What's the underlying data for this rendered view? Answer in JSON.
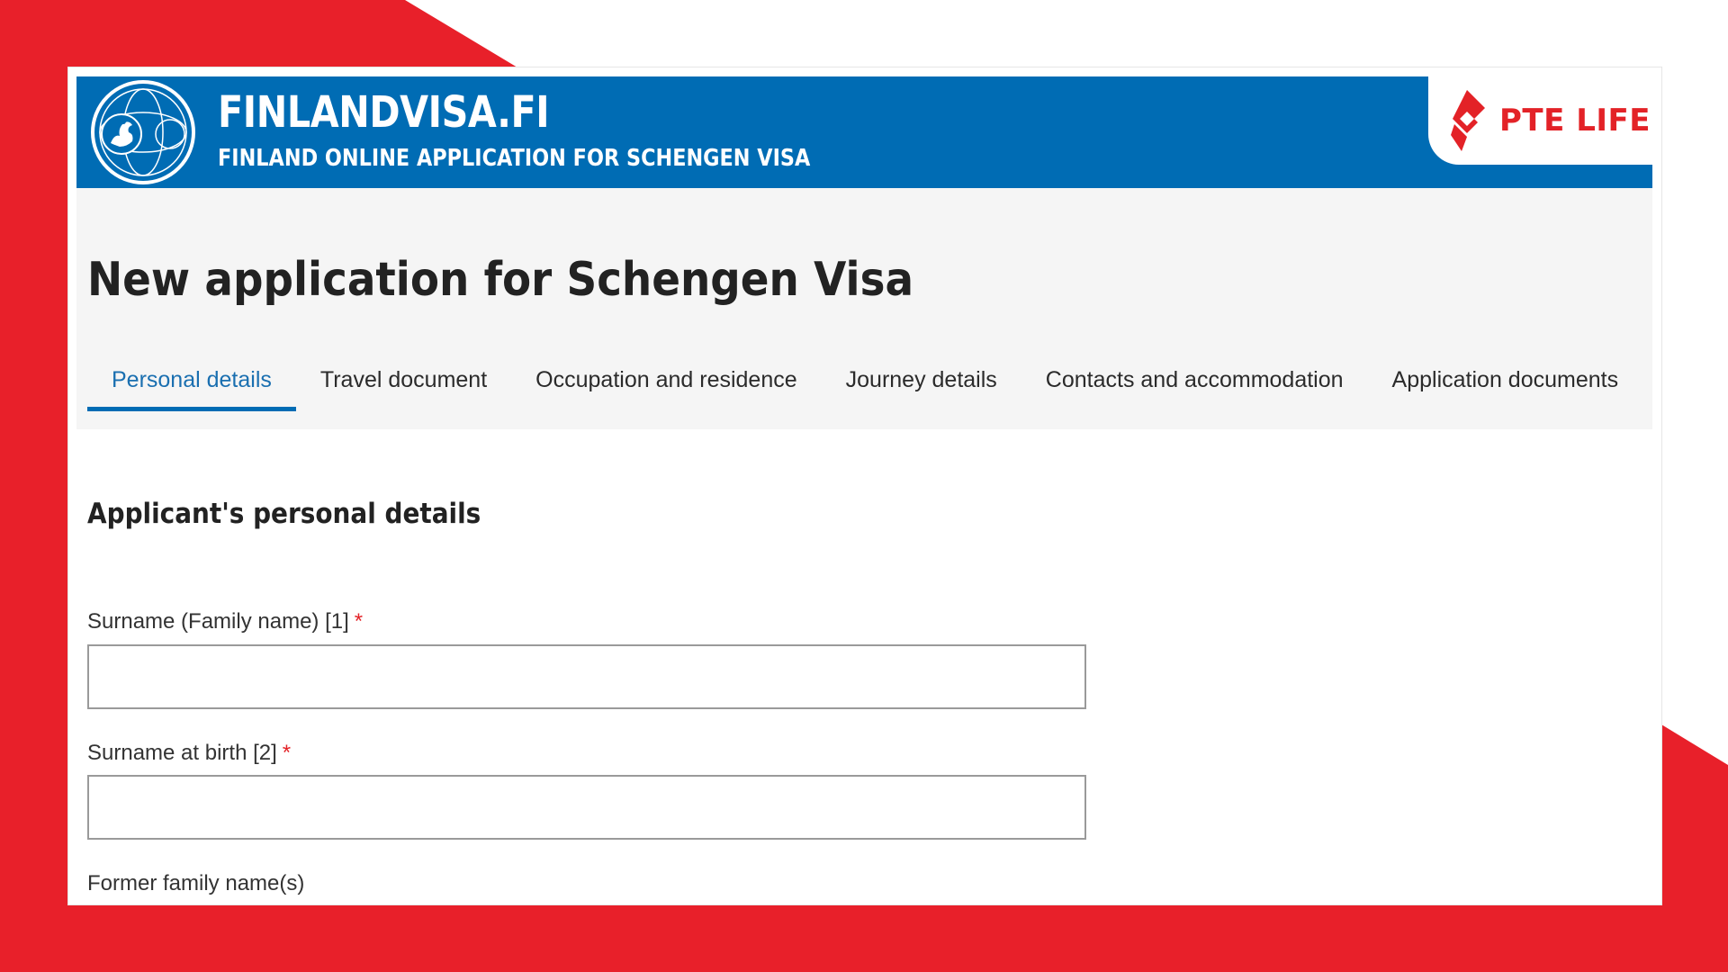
{
  "colors": {
    "accent_blue": "#006cb4",
    "brand_red": "#e32227",
    "tab_active_text": "#1a6fb0",
    "content_bg": "#f5f5f5"
  },
  "header": {
    "site_title": "FINLANDVISA.FI",
    "site_subtitle": "FINLAND ONLINE APPLICATION FOR SCHENGEN VISA",
    "crest_icon": "lion-crest-icon",
    "brand": {
      "icon": "pte-life-logo-icon",
      "text": "PTE LIFE"
    }
  },
  "page": {
    "title": "New application for Schengen Visa"
  },
  "tabs": [
    {
      "label": "Personal details",
      "active": true
    },
    {
      "label": "Travel document",
      "active": false
    },
    {
      "label": "Occupation and residence",
      "active": false
    },
    {
      "label": "Journey details",
      "active": false
    },
    {
      "label": "Contacts and accommodation",
      "active": false
    },
    {
      "label": "Application documents",
      "active": false
    }
  ],
  "form": {
    "section_title": "Applicant's personal details",
    "fields": [
      {
        "label": "Surname (Family name) [1]",
        "required_mark": "*",
        "value": ""
      },
      {
        "label": "Surname at birth [2]",
        "required_mark": "*",
        "value": ""
      },
      {
        "label": "Former family name(s)"
      }
    ]
  }
}
